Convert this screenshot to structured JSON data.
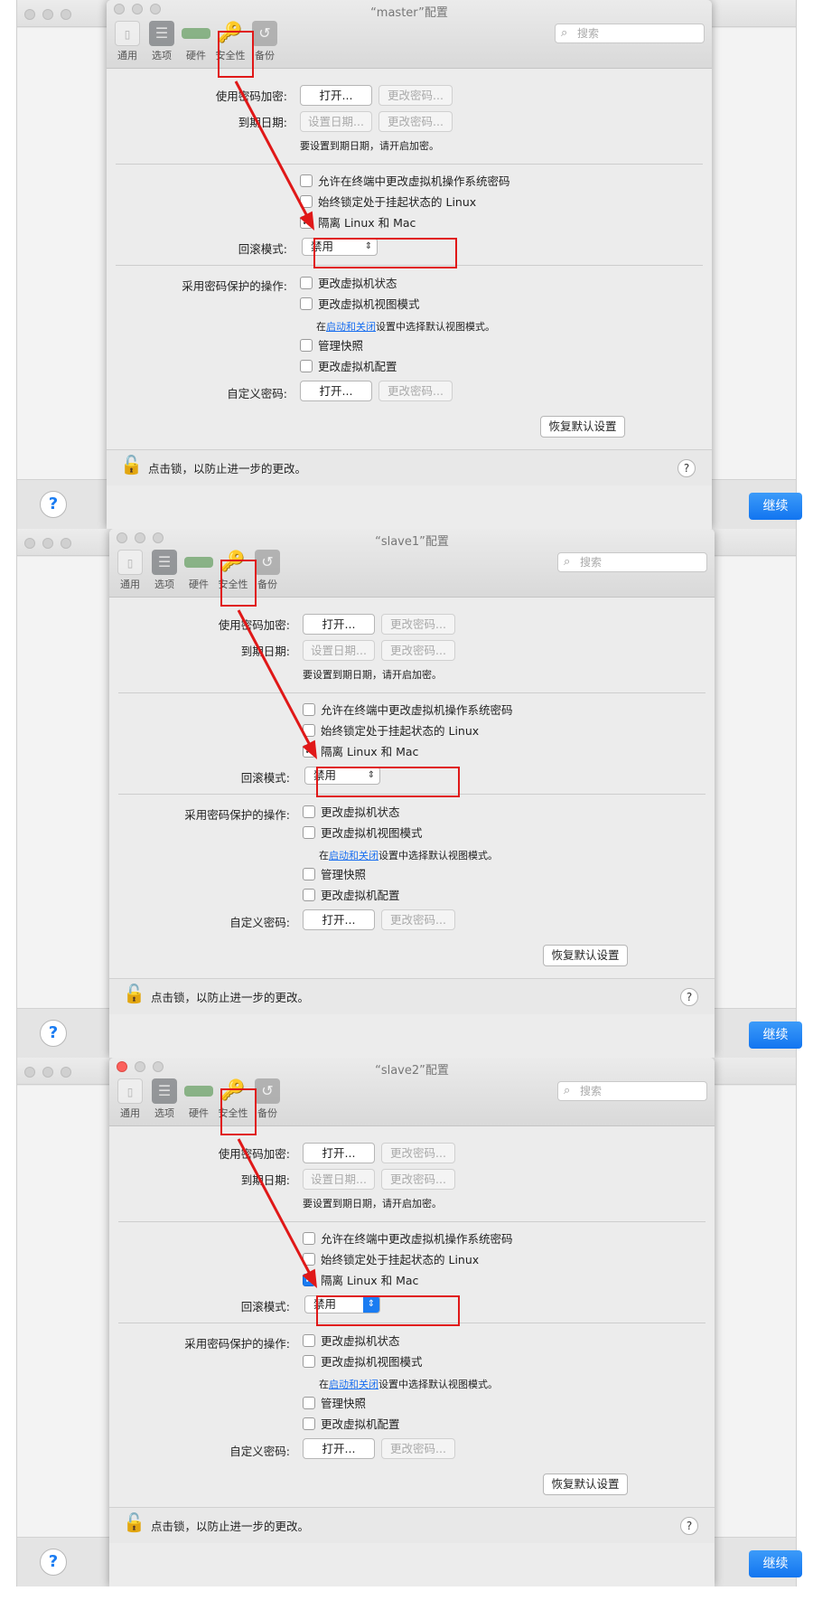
{
  "background_window": {
    "help_label": "?",
    "continue_label": "继续"
  },
  "toolbar": {
    "items": [
      {
        "label": "通用",
        "icon": "general-icon"
      },
      {
        "label": "选项",
        "icon": "options-sliders-icon"
      },
      {
        "label": "硬件",
        "icon": "hardware-memory-icon"
      },
      {
        "label": "安全性",
        "icon": "security-key-icon"
      },
      {
        "label": "备份",
        "icon": "backup-icon"
      }
    ],
    "search_placeholder": "搜索"
  },
  "windows": [
    {
      "title": "“master”配置"
    },
    {
      "title": "“slave1”配置"
    },
    {
      "title": "“slave2”配置"
    }
  ],
  "security": {
    "encrypt_label": "使用密码加密:",
    "open_button": "打开...",
    "change_password_button": "更改密码...",
    "expiry_label": "到期日期:",
    "set_date_button": "设置日期...",
    "expiry_note": "要设置到期日期，请开启加密。",
    "allow_terminal_change": "允许在终端中更改虚拟机操作系统密码",
    "always_lock_suspended": "始终锁定处于挂起状态的 Linux",
    "isolate_linux_mac": "隔离 Linux 和 Mac",
    "rollback_label": "回滚模式:",
    "rollback_value": "禁用",
    "protected_ops_label": "采用密码保护的操作:",
    "op_change_state": "更改虚拟机状态",
    "op_change_view": "更改虚拟机视图模式",
    "view_note_prefix": "在",
    "view_note_link": "启动和关闭",
    "view_note_suffix": "设置中选择默认视图模式。",
    "op_manage_snapshots": "管理快照",
    "op_change_config": "更改虚拟机配置",
    "custom_password_label": "自定义密码:",
    "restore_defaults": "恢复默认设置",
    "lock_text": "点击锁，以防止进一步的更改。",
    "lock_help": "?"
  },
  "state": {
    "isolate_checked": true,
    "other_checkboxes_checked": false
  },
  "colors": {
    "highlight": "#e01818",
    "accent": "#1a7cf2"
  }
}
